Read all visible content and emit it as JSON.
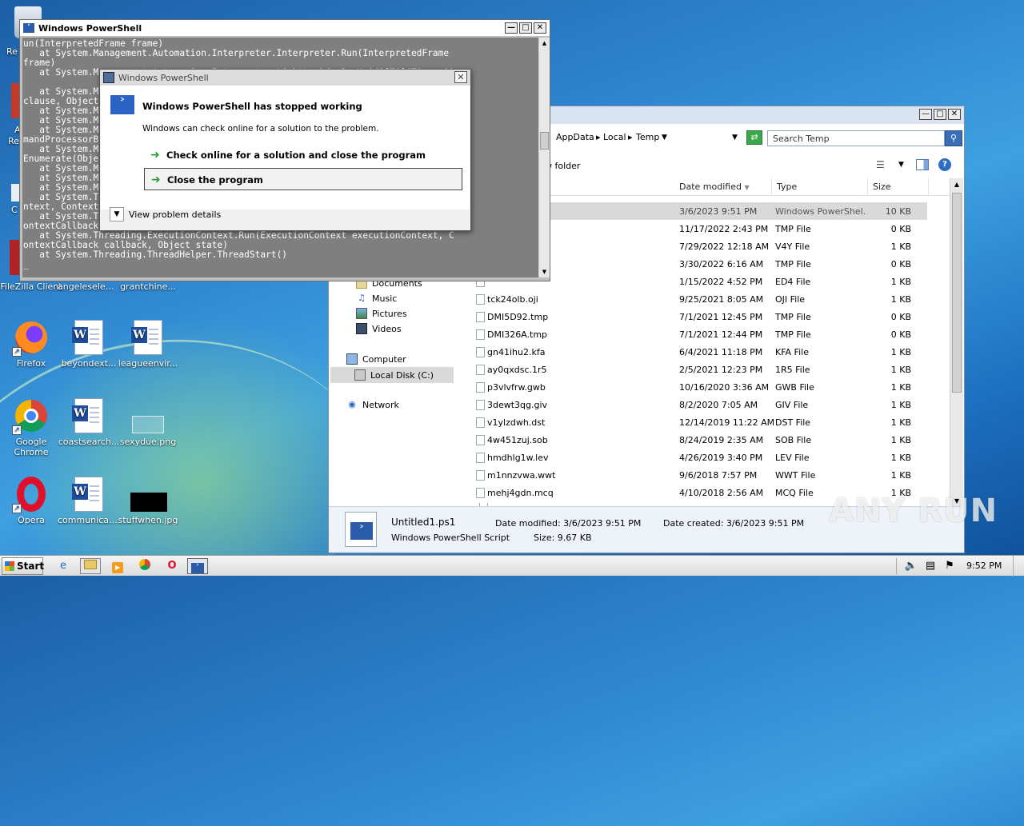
{
  "desktop": {
    "icons": [
      {
        "label": "FileZilla Client"
      },
      {
        "label": "angeleselem..."
      },
      {
        "label": "grantchine..."
      },
      {
        "label": "Firefox"
      },
      {
        "label": "beyondext..."
      },
      {
        "label": "leagueenvir..."
      },
      {
        "label": "Google Chrome"
      },
      {
        "label": "coastsearch..."
      },
      {
        "label": "sexydue.png"
      },
      {
        "label": "Opera"
      },
      {
        "label": "communicati..."
      },
      {
        "label": "stuffwhen.jpg"
      }
    ],
    "partial_labels": [
      "Re",
      "A",
      "Re",
      "C"
    ]
  },
  "powershell": {
    "title": "Windows PowerShell",
    "lines": [
      "un(InterpretedFrame frame)",
      "   at System.Management.Automation.Interpreter.Interpreter.Run(InterpretedFrame",
      "frame)",
      "   at System.Management.Automation.Interpreter.LightLambda.RunVoid1[T0](T0 arg0)",
      "",
      "   at System.Management.Automation.DlrScriptCommandProcessor.RunClause(Action`1",
      "clause, Object dollarUnderbar, Object inputToProcess)",
      "   at System.Management.Automation.DlrScriptCommandProcessor.Complete()",
      "   at System.Management.Automation.CommandProcessorBase.DoComplete()",
      "   at System.Management.Automation.Internal.PipelineProcessor.DoCompleteCore(Com",
      "mandProcessorBase commandRequestingUpstreamCommandsToStop)",
      "   at System.Management.Automation.Internal.PipelineProcessor.SynchronousExecute",
      "Enumerate(Object input, Hashtable errorResults, Boolean enumerate)",
      "   at System.Management.Automation.Runspaces.LocalPipeline.InvokeHelper()",
      "   at System.Management.Automation.Runspaces.LocalPipeline.InvokeThreadProc()",
      "   at System.Management.Automation.Runspaces.PipelineThread.WorkerProc()",
      "   at System.Threading.ExecutionContext.RunInternal(ExecutionCo",
      "ntext, ContextCallback callback, Object state, Boolean preserveSyncCtx)",
      "   at System.Threading.ExecutionContext.Run(ExecutionContext executionContext, C",
      "ontextCallback callback, Object state, Boolean preserveSyncCtx)",
      "   at System.Threading.ExecutionContext.Run(ExecutionContext executionContext, C",
      "ontextCallback callback, Object state)",
      "   at System.Threading.ThreadHelper.ThreadStart()",
      "_"
    ]
  },
  "dialog": {
    "title": "Windows PowerShell",
    "heading": "Windows PowerShell has stopped working",
    "message": "Windows can check online for a solution to the problem.",
    "option_online": "Check online for a solution and close the program",
    "option_close": "Close the program",
    "details": "View problem details"
  },
  "explorer": {
    "breadcrumb": [
      "AppData",
      "Local",
      "Temp"
    ],
    "search_placeholder": "Search Temp",
    "toolbar_partial": "w folder",
    "columns": {
      "date": "Date modified",
      "type": "Type",
      "size": "Size"
    },
    "nav": [
      {
        "label": "Documents",
        "icon": "documents-icon"
      },
      {
        "label": "Music",
        "icon": "music-icon"
      },
      {
        "label": "Pictures",
        "icon": "pictures-icon"
      },
      {
        "label": "Videos",
        "icon": "videos-icon"
      },
      {
        "label": "Computer",
        "icon": "computer-icon"
      },
      {
        "label": "Local Disk (C:)",
        "icon": "disk-icon"
      },
      {
        "label": "Network",
        "icon": "network-icon"
      }
    ],
    "files": [
      {
        "name": "",
        "date": "3/6/2023 9:51 PM",
        "type": "Windows PowerShel...",
        "size": "10 KB"
      },
      {
        "name": "",
        "date": "11/17/2022 2:43 PM",
        "type": "TMP File",
        "size": "0 KB"
      },
      {
        "name": "",
        "date": "7/29/2022 12:18 AM",
        "type": "V4Y File",
        "size": "1 KB"
      },
      {
        "name": "",
        "date": "3/30/2022 6:16 AM",
        "type": "TMP File",
        "size": "0 KB"
      },
      {
        "name": "",
        "date": "1/15/2022 4:52 PM",
        "type": "ED4 File",
        "size": "1 KB"
      },
      {
        "name": "tck24olb.oji",
        "date": "9/25/2021 8:05 AM",
        "type": "OJI File",
        "size": "1 KB"
      },
      {
        "name": "DMI5D92.tmp",
        "date": "7/1/2021 12:45 PM",
        "type": "TMP File",
        "size": "0 KB"
      },
      {
        "name": "DMI326A.tmp",
        "date": "7/1/2021 12:44 PM",
        "type": "TMP File",
        "size": "0 KB"
      },
      {
        "name": "gn41ihu2.kfa",
        "date": "6/4/2021 11:18 PM",
        "type": "KFA File",
        "size": "1 KB"
      },
      {
        "name": "ay0qxdsc.1r5",
        "date": "2/5/2021 12:23 PM",
        "type": "1R5 File",
        "size": "1 KB"
      },
      {
        "name": "p3vlvfrw.gwb",
        "date": "10/16/2020 3:36 AM",
        "type": "GWB File",
        "size": "1 KB"
      },
      {
        "name": "3dewt3qg.giv",
        "date": "8/2/2020 7:05 AM",
        "type": "GIV File",
        "size": "1 KB"
      },
      {
        "name": "v1ylzdwh.dst",
        "date": "12/14/2019 11:22 AM",
        "type": "DST File",
        "size": "1 KB"
      },
      {
        "name": "4w451zuj.sob",
        "date": "8/24/2019 2:35 AM",
        "type": "SOB File",
        "size": "1 KB"
      },
      {
        "name": "hmdhlg1w.lev",
        "date": "4/26/2019 3:40 PM",
        "type": "LEV File",
        "size": "1 KB"
      },
      {
        "name": "m1nnzvwa.wwt",
        "date": "9/6/2018 7:57 PM",
        "type": "WWT File",
        "size": "1 KB"
      },
      {
        "name": "mehj4gdn.mcq",
        "date": "4/10/2018 2:56 AM",
        "type": "MCQ File",
        "size": "1 KB"
      }
    ],
    "details": {
      "name": "Untitled1.ps1",
      "kind": "Windows PowerShell Script",
      "modified": "Date modified: 3/6/2023 9:51 PM",
      "created": "Date created: 3/6/2023 9:51 PM",
      "size": "Size: 9.67 KB"
    }
  },
  "taskbar": {
    "start": "Start",
    "clock": "9:52 PM"
  },
  "watermark": "ANY RUN"
}
